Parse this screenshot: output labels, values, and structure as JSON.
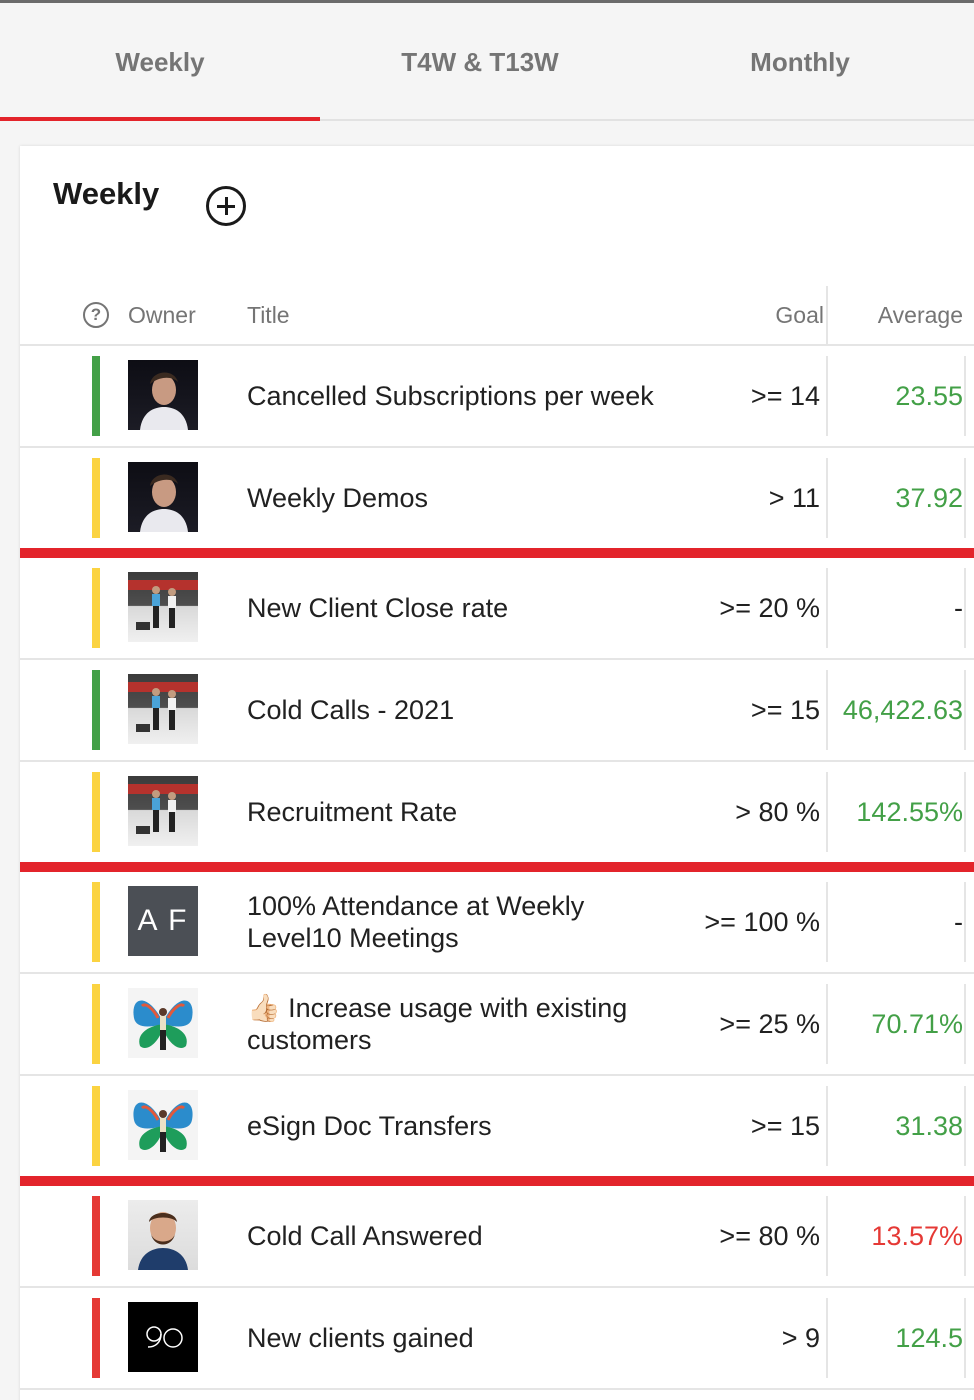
{
  "tabs": [
    {
      "label": "Weekly",
      "active": true
    },
    {
      "label": "T4W & T13W",
      "active": false
    },
    {
      "label": "Monthly",
      "active": false
    }
  ],
  "card": {
    "title": "Weekly"
  },
  "columns": {
    "owner": "Owner",
    "title": "Title",
    "goal": "Goal",
    "average": "Average"
  },
  "colors": {
    "accent": "#e3242b",
    "green": "#43a047",
    "yellow": "#fbd341",
    "red": "#e53935"
  },
  "rows": [
    {
      "status": "green",
      "owner_avatar": "photo-man-1",
      "title": "Cancelled Subscriptions per week",
      "goal": ">= 14",
      "average": "23.55",
      "avg_status": "green"
    },
    {
      "status": "yellow",
      "owner_avatar": "photo-man-1",
      "title": "Weekly Demos",
      "goal": "> 11",
      "average": "37.92",
      "avg_status": "green"
    },
    {
      "status": "yellow",
      "owner_avatar": "photo-group",
      "title": "New Client Close rate",
      "goal": ">= 20 %",
      "average": "-",
      "avg_status": "none"
    },
    {
      "status": "green",
      "owner_avatar": "photo-group",
      "title": "Cold Calls - 2021",
      "goal": ">= 15",
      "average": "46,422.63",
      "avg_status": "green"
    },
    {
      "status": "yellow",
      "owner_avatar": "photo-group",
      "title": "Recruitment Rate",
      "goal": "> 80 %",
      "average": "142.55%",
      "avg_status": "green"
    },
    {
      "status": "yellow",
      "owner_initials": "A F",
      "title": "100% Attendance at Weekly Level10 Meetings",
      "goal": ">= 100 %",
      "average": "-",
      "avg_status": "none"
    },
    {
      "status": "yellow",
      "owner_avatar": "photo-butterfly",
      "title": "👍🏻 Increase usage with existing customers",
      "goal": ">= 25 %",
      "average": "70.71%",
      "avg_status": "green"
    },
    {
      "status": "yellow",
      "owner_avatar": "photo-butterfly",
      "title": "eSign Doc Transfers",
      "goal": ">= 15",
      "average": "31.38",
      "avg_status": "green"
    },
    {
      "status": "red",
      "owner_avatar": "photo-man-2",
      "title": "Cold Call Answered",
      "goal": ">= 80 %",
      "average": "13.57%",
      "avg_status": "red"
    },
    {
      "status": "red",
      "owner_logo": "9O",
      "title": "New clients gained",
      "goal": "> 9",
      "average": "124.5",
      "avg_status": "green"
    }
  ]
}
